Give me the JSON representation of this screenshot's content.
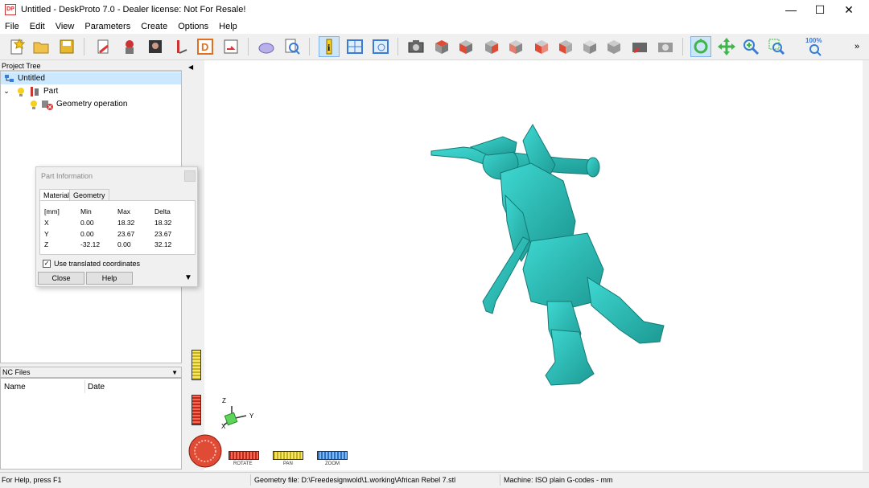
{
  "window": {
    "title": "Untitled - DeskProto 7.0 - Dealer license: Not For Resale!",
    "app_icon_text": "DP",
    "minimize": "—",
    "maximize": "☐",
    "close": "✕"
  },
  "menu": [
    "File",
    "Edit",
    "View",
    "Parameters",
    "Create",
    "Options",
    "Help"
  ],
  "toolbar": {
    "zoom_label": "100%",
    "overflow": "»"
  },
  "project_tree": {
    "header": "Project Tree",
    "root": "Untitled",
    "part": "Part",
    "operation": "Geometry operation"
  },
  "nc_files": {
    "header": "NC Files",
    "columns": [
      "Name",
      "Date"
    ]
  },
  "part_info": {
    "title": "Part Information",
    "tabs": [
      "Material",
      "Geometry"
    ],
    "headers": [
      "[mm]",
      "Min",
      "Max",
      "Delta"
    ],
    "rows": [
      [
        "X",
        "0.00",
        "18.32",
        "18.32"
      ],
      [
        "Y",
        "0.00",
        "23.67",
        "23.67"
      ],
      [
        "Z",
        "-32.12",
        "0.00",
        "32.12"
      ]
    ],
    "checkbox_label": "Use translated coordinates",
    "checkbox_checked": true,
    "close_button": "Close",
    "help_button": "Help"
  },
  "view_controls": {
    "rotate": "ROTATE",
    "pan": "PAN",
    "zoom": "ZOOM"
  },
  "axes": {
    "x": "X",
    "y": "Y",
    "z": "Z"
  },
  "status": {
    "help": "For Help, press F1",
    "geometry_file": "Geometry file: D:\\Freedesignwold\\1.working\\African Rebel 7.stl",
    "machine": "Machine: ISO plain G-codes - mm"
  },
  "colors": {
    "model": "#2fc4c0",
    "model_shade": "#1e8e8a",
    "accent_red": "#e04b36",
    "accent_yellow": "#e8d431",
    "accent_blue": "#3d8fe0"
  }
}
